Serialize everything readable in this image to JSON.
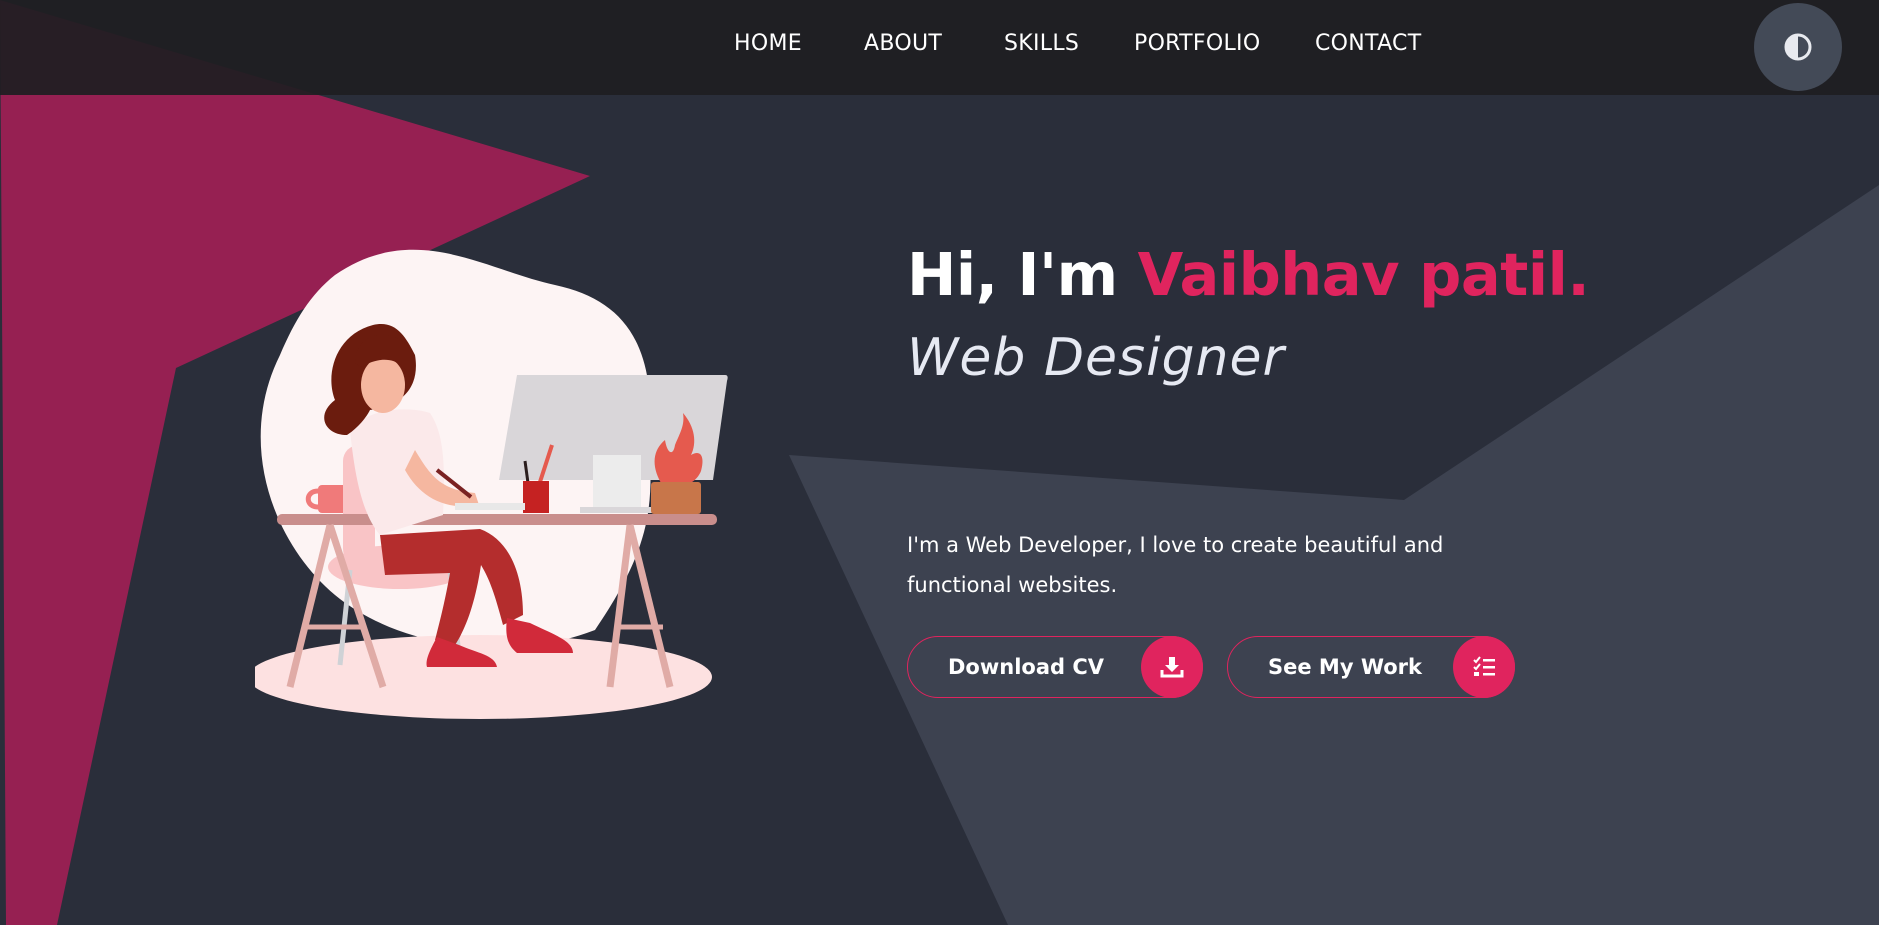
{
  "nav": {
    "items": [
      "HOME",
      "ABOUT",
      "SKILLS",
      "PORTFOLIO",
      "CONTACT"
    ],
    "theme_toggle_icon": "contrast-icon"
  },
  "hero": {
    "greeting": "Hi, I'm ",
    "name": "Vaibhav patil.",
    "role": "Web Designer",
    "description": "I'm a Web Developer, I love to create beautiful and functional websites.",
    "illustration": "woman-at-desk-illustration"
  },
  "buttons": {
    "download_cv": {
      "label": "Download CV",
      "icon": "download-icon"
    },
    "see_work": {
      "label": "See My Work",
      "icon": "checklist-icon"
    }
  },
  "colors": {
    "accent": "#e0245e",
    "background": "#2a2e3a",
    "navbar": "#1e1e21",
    "triangle": "#962052",
    "panel": "#3d4250"
  }
}
